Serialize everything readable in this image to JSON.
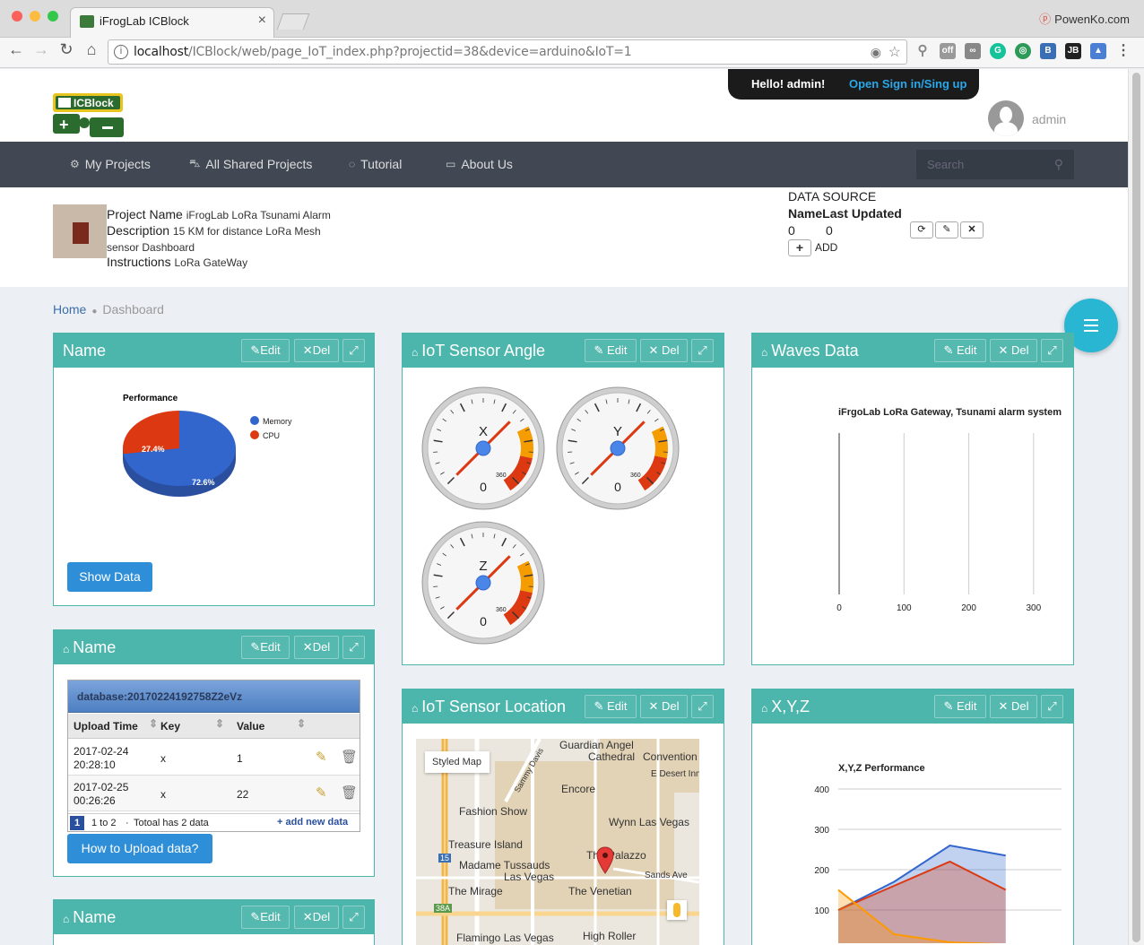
{
  "browser": {
    "tab_title": "iFrogLab ICBlock",
    "profile_name": "PowenKo.com",
    "url_host": "localhost",
    "url_path": "/ICBlock/web/page_IoT_index.php?projectid=38&device=arduino&IoT=1"
  },
  "header": {
    "logo_text": "ICBlock",
    "hello": "Hello! admin!",
    "signin": "Open Sign in/Sing up",
    "username": "admin"
  },
  "nav": {
    "items": [
      "My Projects",
      "All Shared Projects",
      "Tutorial",
      "About Us"
    ],
    "search_placeholder": "Search"
  },
  "project": {
    "name_label": "Project Name",
    "name_value": "iFrogLab LoRa Tsunami Alarm",
    "desc_label": "Description",
    "desc_value_1": "15 KM for distance LoRa Mesh",
    "desc_value_2": "sensor Dashboard",
    "instr_label": "Instructions",
    "instr_value": "LoRa GateWay"
  },
  "data_source": {
    "title": "DATA SOURCE",
    "col_name": "Name",
    "col_updated": "Last Updated",
    "name_value": "0",
    "updated_value": "0",
    "add_label": "ADD"
  },
  "breadcrumb": {
    "home": "Home",
    "current": "Dashboard"
  },
  "panel_buttons": {
    "edit": "Edit",
    "del": "Del"
  },
  "panels": {
    "name1": {
      "title": "Name",
      "button": "Show Data"
    },
    "angle": {
      "title": "IoT Sensor Angle"
    },
    "waves": {
      "title": "Waves Data"
    },
    "name2": {
      "title": "Name",
      "button": "How to Upload data?"
    },
    "location": {
      "title": "IoT Sensor Location"
    },
    "xyz": {
      "title": "X,Y,Z"
    },
    "name3": {
      "title": "Name"
    }
  },
  "pie": {
    "title": "Performance",
    "legend": [
      "Memory",
      "CPU"
    ],
    "labels": [
      "72.6%",
      "27.4%"
    ],
    "colors": [
      "#3366cc",
      "#dc3912"
    ]
  },
  "gauges": [
    {
      "letter": "X",
      "value": "0",
      "max": "360"
    },
    {
      "letter": "Y",
      "value": "0",
      "max": "360"
    },
    {
      "letter": "Z",
      "value": "0",
      "max": "360"
    }
  ],
  "table": {
    "title": "database:20170224192758Z2eVz",
    "headers": [
      "Upload Time",
      "Key",
      "Value"
    ],
    "rows": [
      {
        "time1": "2017-02-24",
        "time2": "20:28:10",
        "key": "x",
        "value": "1"
      },
      {
        "time1": "2017-02-25",
        "time2": "00:26:26",
        "key": "x",
        "value": "22"
      }
    ],
    "page": "1",
    "range": "1 to 2",
    "total": "Totoal has 2 data",
    "add_new": "+ add new data"
  },
  "map": {
    "styled_label": "Styled Map",
    "places": [
      "Guardian Angel",
      "Cathedral",
      "Convention",
      "E Desert Inn",
      "Encore",
      "Fashion Show",
      "Wynn Las Vegas",
      "Treasure Island",
      "The Palazzo",
      "Madame Tussauds",
      "Las Vegas",
      "Sands Ave",
      "The Mirage",
      "The Venetian",
      "Flamingo Las Vegas",
      "High Roller",
      "Sammy Davis",
      "15",
      "38A"
    ]
  },
  "chart_data": [
    {
      "type": "line",
      "title": "iFrgoLab LoRa Gateway, Tsunami alarm system",
      "x_ticks": [
        "0",
        "100",
        "200",
        "300"
      ],
      "xlim": [
        0,
        350
      ],
      "series": []
    },
    {
      "type": "area",
      "title": "X,Y,Z Performance",
      "y_ticks": [
        "100",
        "200",
        "300",
        "400"
      ],
      "ylim": [
        0,
        400
      ],
      "x": [
        0,
        1,
        2,
        3,
        4
      ],
      "series": [
        {
          "values": [
            100,
            170,
            260,
            235
          ],
          "color": "#3366cc"
        },
        {
          "values": [
            100,
            160,
            220,
            150
          ],
          "color": "#dc3912"
        },
        {
          "values": [
            150,
            40,
            20,
            15
          ],
          "color": "#ff9900"
        }
      ]
    }
  ]
}
